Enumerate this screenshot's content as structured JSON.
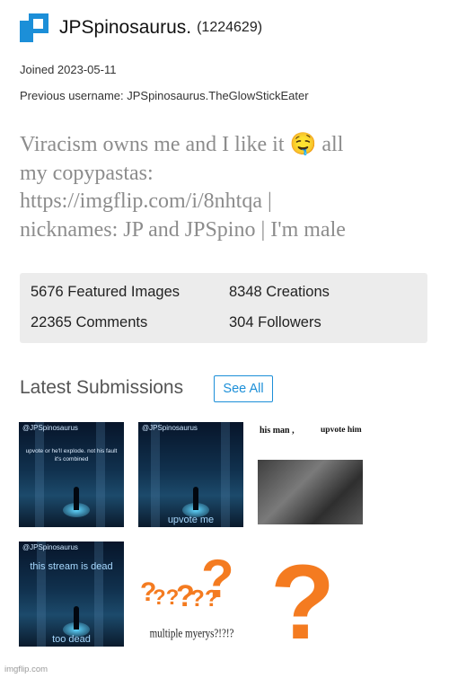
{
  "header": {
    "username": "JPSpinosaurus.",
    "user_id": "(1224629)"
  },
  "meta": {
    "joined": "Joined 2023-05-11",
    "previous_username": "Previous username: JPSpinosaurus.TheGlowStickEater"
  },
  "bio": {
    "lines": [
      "Viracism owns me and I like it 🤤 all",
      "my copypastas:",
      "https://imgflip.com/i/8nhtqa |",
      "nicknames: JP and JPSpino | I'm male"
    ]
  },
  "stats": {
    "featured_images": "5676 Featured Images",
    "creations": "8348 Creations",
    "comments": "22365 Comments",
    "followers": "304 Followers"
  },
  "submissions": {
    "title": "Latest Submissions",
    "see_all_label": "See All",
    "items": [
      {
        "watermark": "@JPSpinosaurus",
        "caption_top": "upvote or he'll explode. not his fault it's combined",
        "caption_bottom": ""
      },
      {
        "watermark": "@JPSpinosaurus",
        "caption_top": "",
        "caption_bottom": "upvote me"
      },
      {
        "caption_left": "his man ,",
        "caption_right": "upvote him"
      },
      {
        "watermark": "@JPSpinosaurus",
        "caption_top": "this stream is dead",
        "caption_bottom": "too dead"
      },
      {
        "caption_bottom": "multiple myerys?!?!?"
      },
      {}
    ]
  },
  "footer": {
    "text": "imgflip.com"
  },
  "colors": {
    "accent": "#1c8fd8",
    "bio_text": "#8c8c8c",
    "stats_bg": "#ececec",
    "question_orange": "#f47b20"
  },
  "icons": {
    "logo": "imgflip-logo-icon",
    "question": "question-mark-icon"
  }
}
